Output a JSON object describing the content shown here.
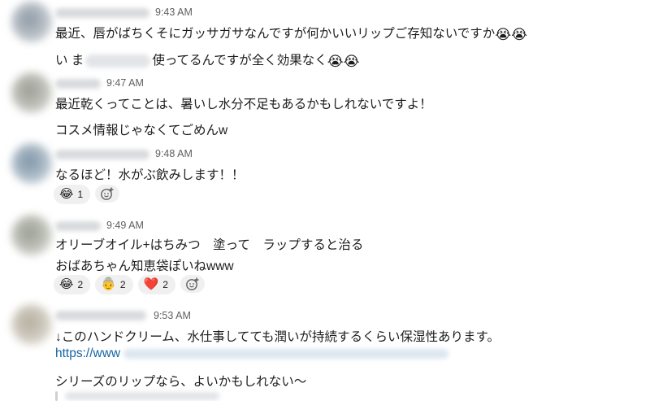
{
  "messages": [
    {
      "time": "9:43 AM",
      "lines": [
        "最近、唇がばちくそにガッサガサなんですが何かいいリップご存知ないですか",
        "い ま",
        "使ってるんですが全く効果なく"
      ],
      "emoji": "😭"
    },
    {
      "time": "9:47 AM",
      "lines": [
        "最近乾くってことは、暑いし水分不足もあるかもしれないですよ！",
        "コスメ情報じゃなくてごめんw"
      ]
    },
    {
      "time": "9:48 AM",
      "lines": [
        "なるほど！水がぶ飲みします！！"
      ],
      "reactions": [
        {
          "emoji": "😂",
          "count": "1"
        }
      ]
    },
    {
      "time": "9:49 AM",
      "lines": [
        "オリーブオイル+はちみつ　塗って　ラップすると治る",
        "おばあちゃん知恵袋ぽいねwww"
      ],
      "reactions": [
        {
          "emoji": "😂",
          "count": "2"
        },
        {
          "emoji": "👵",
          "count": "2"
        },
        {
          "emoji": "❤️",
          "count": "2"
        }
      ]
    },
    {
      "time": "9:53 AM",
      "lines": [
        "↓このハンドクリーム、水仕事してても潤いが持続するくらい保湿性あります。",
        "https://www",
        "シリーズのリップなら、よいかもしれない〜"
      ]
    }
  ],
  "icons": {
    "add_reaction": "add-reaction-icon"
  },
  "colors": {
    "link": "#1264a3",
    "reaction_bg": "#f0f0f0",
    "timestamp": "#616061"
  }
}
